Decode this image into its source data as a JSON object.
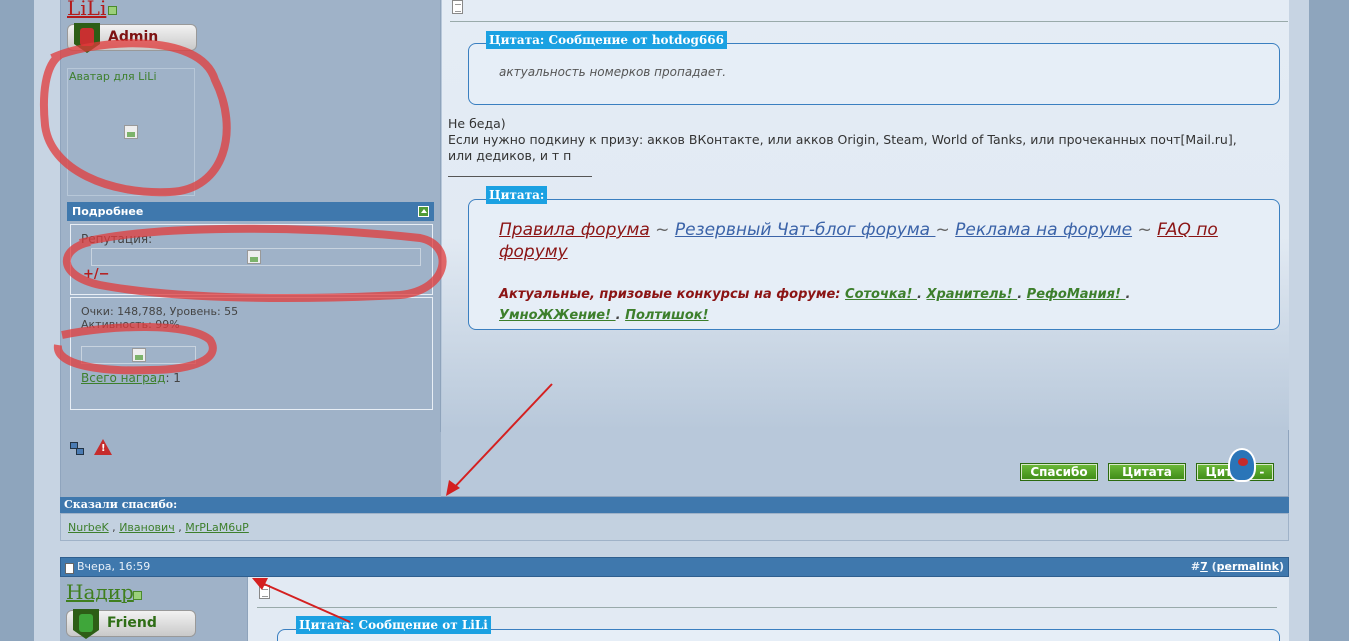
{
  "post1": {
    "username": "LiLi",
    "rank": "Admin",
    "avatar_caption": "Аватар для LiLi",
    "details_header": "Подробнее",
    "reputation_label": "Репутация:",
    "rep_symbols": "+/−",
    "stats_line1": "Очки: 148,788, Уровень: 55",
    "stats_line2": "Активность: 99%",
    "awards_link": "Всего наград",
    "awards_count": ": 1",
    "quote1_title": "Цитата: Сообщение от hotdog666",
    "quote1_text": "актуальность номерков пропадает.",
    "message_line1": "Не беда)",
    "message_line2": "Если нужно подкину к призу: акков ВКонтакте, или акков Origin, Steam, World of Tanks, или прочеканных почт[Mail.ru],",
    "message_line3": "или дедиков, и т п",
    "quote2_title": "Цитата:",
    "sig_links": {
      "rules": "Правила форума",
      "tilde": " ~ ",
      "chat": "Резервный Чат-блог форума ",
      "ads": "Реклама на форуме",
      "faq": " FAQ по форуму "
    },
    "contests_label": "Актуальные, призовые конкурсы на форуме:",
    "contests": [
      "Соточка! ",
      " Хранитель! ",
      " РефоМания! ",
      "УмноЖЖение! ",
      " Полтишок!"
    ],
    "contest_sep": ".",
    "buttons": {
      "thanks": "Спасибо",
      "quote": "Цитата",
      "quote_multi": "Цитата -"
    }
  },
  "thanks_section": {
    "header": "Сказали спасибо:",
    "users": [
      "NurbeK",
      "Иванович",
      "MrPLaM6uP"
    ],
    "separator": " , "
  },
  "post2": {
    "date": "Вчера, 16:59",
    "post_number": "7",
    "hash": "#",
    "permalink": "permalink",
    "username": "Надир",
    "rank": "Friend",
    "quote_title": "Цитата: Сообщение от LiLi"
  },
  "colors": {
    "header_blue": "#3f78ad",
    "quote_blue": "#1ba1e2",
    "link_green": "#3d7f2c",
    "admin_red": "#b41a1a",
    "annotation_red": "#e23b3b"
  }
}
